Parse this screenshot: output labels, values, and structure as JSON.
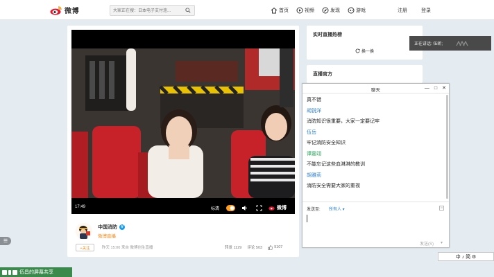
{
  "header": {
    "logo_text": "微博",
    "search_placeholder": "大家正在搜：日本电子支付连...",
    "nav": [
      {
        "label": "首页",
        "icon": "home-icon"
      },
      {
        "label": "视频",
        "icon": "video-icon"
      },
      {
        "label": "发现",
        "icon": "discover-icon"
      },
      {
        "label": "游戏",
        "icon": "game-icon"
      }
    ],
    "register": "注册",
    "login": "登录"
  },
  "video": {
    "time": "17:49",
    "quality": "标清",
    "watermark": "微博",
    "author": "中国消防",
    "verified": "V",
    "source": "微博直播",
    "follow": "+关注",
    "post_time": "昨天 15:00 来自 微博创生直播",
    "stats": {
      "forward": "转发 1129",
      "comment": "评论 503",
      "like": "9107"
    }
  },
  "right_panel": {
    "hot_title": "实时直播热榜",
    "swap": "换一换",
    "official_title": "直播官方"
  },
  "speaking": "正在讲话: 伍昕;",
  "chat": {
    "title": "聊天",
    "messages": [
      {
        "type": "text",
        "text": "真不错"
      },
      {
        "type": "sender",
        "text": "胡锐洋",
        "color": "#2b7fd6"
      },
      {
        "type": "text",
        "text": "消防知识很重要，大家一定要记牢"
      },
      {
        "type": "sender",
        "text": "伍岳",
        "color": "#2b7fd6"
      },
      {
        "type": "text",
        "text": "牢记消防安全知识"
      },
      {
        "type": "sender",
        "text": "谭嘉翊",
        "color": "#2aa55a"
      },
      {
        "type": "text",
        "text": "不能忘记这些血淋淋的教训"
      },
      {
        "type": "sender",
        "text": "胡雅莉",
        "color": "#2b7fd6"
      },
      {
        "type": "text",
        "text": "消防安全需要大家的重视"
      }
    ],
    "send_to_label": "发送至:",
    "recipient": "所有人",
    "send_button": "发送(S)",
    "send_menu": "▾"
  },
  "ime": {
    "label": "中 ♪ 简 ⚙"
  },
  "share_bar": {
    "label": "伍昌的屏幕共享"
  },
  "side_tab": "☰"
}
